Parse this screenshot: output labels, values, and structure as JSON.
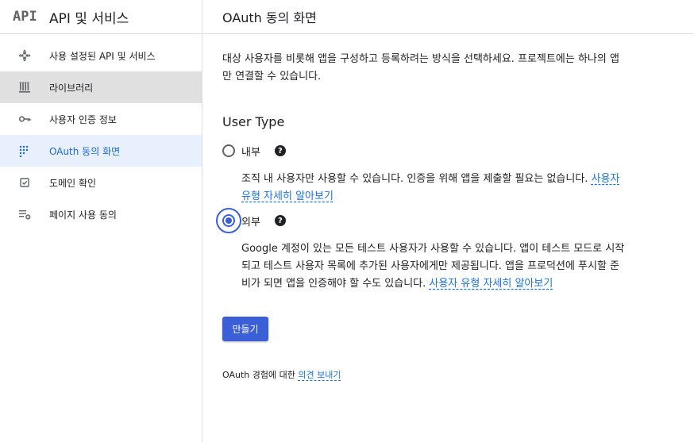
{
  "sidebar": {
    "logo": "API",
    "title": "API 및 서비스",
    "items": [
      {
        "label": "사용 설정된 API 및 서비스",
        "icon": "apis-move-icon"
      },
      {
        "label": "라이브러리",
        "icon": "library-icon"
      },
      {
        "label": "사용자 인증 정보",
        "icon": "key-icon"
      },
      {
        "label": "OAuth 동의 화면",
        "icon": "oauth-dots-icon"
      },
      {
        "label": "도메인 확인",
        "icon": "checkbox-icon"
      },
      {
        "label": "페이지 사용 동의",
        "icon": "list-settings-icon"
      }
    ]
  },
  "header": {
    "title": "OAuth 동의 화면"
  },
  "main": {
    "intro": "대상 사용자를 비롯해 앱을 구성하고 등록하려는 방식을 선택하세요. 프로젝트에는 하나의 앱만 연결할 수 있습니다.",
    "section_title": "User Type",
    "options": [
      {
        "label": "내부",
        "checked": false,
        "description": "조직 내 사용자만 사용할 수 있습니다. 인증을 위해 앱을 제출할 필요는 없습니다.",
        "link": "사용자 유형 자세히 알아보기"
      },
      {
        "label": "외부",
        "checked": true,
        "description": "Google 계정이 있는 모든 테스트 사용자가 사용할 수 있습니다. 앱이 테스트 모드로 시작되고 테스트 사용자 목록에 추가된 사용자에게만 제공됩니다. 앱을 프로덕션에 푸시할 준비가 되면 앱을 인증해야 할 수도 있습니다.",
        "link": "사용자 유형 자세히 알아보기"
      }
    ],
    "help_glyph": "?",
    "create_label": "만들기",
    "feedback_prefix": "OAuth 경험에 대한",
    "feedback_link": "의견 보내기"
  },
  "colors": {
    "accent": "#3b5fd6",
    "link": "#1a73e8",
    "selected_bg": "#e0e0e0",
    "current_bg": "#e8f0fe"
  }
}
